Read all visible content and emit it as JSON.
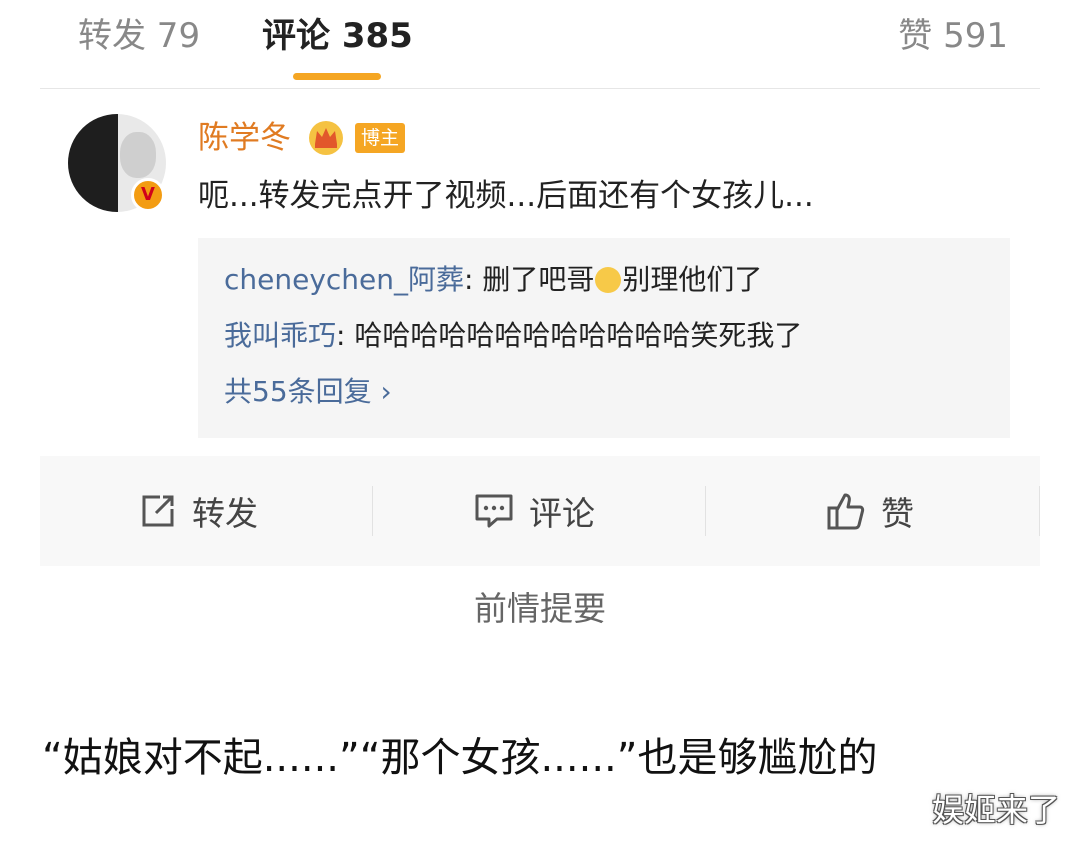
{
  "tabs": {
    "repost_label": "转发 79",
    "comment_label": "评论 385",
    "like_label": "赞 591"
  },
  "comment": {
    "username": "陈学冬",
    "badge": "博主",
    "verified_icon": "verified-v-icon",
    "crown_icon": "crown-icon",
    "text": "呃...转发完点开了视频...后面还有个女孩儿..."
  },
  "replies": [
    {
      "name": "cheneychen_阿葬",
      "text_before": "删了吧哥",
      "emoji": "sad-face-icon",
      "text_after": "别理他们了"
    },
    {
      "name": "我叫乖巧",
      "text": "哈哈哈哈哈哈哈哈哈哈哈哈笑死我了"
    }
  ],
  "replies_more": "共55条回复 ›",
  "actions": {
    "repost": "转发",
    "comment": "评论",
    "like": "赞"
  },
  "summary": "前情提要",
  "caption": "“姑娘对不起......”“那个女孩......”也是够尴尬的",
  "watermark": "娱姬来了",
  "colors": {
    "accent": "#f5a623",
    "username": "#e07b22",
    "link": "#4a6b9a"
  }
}
